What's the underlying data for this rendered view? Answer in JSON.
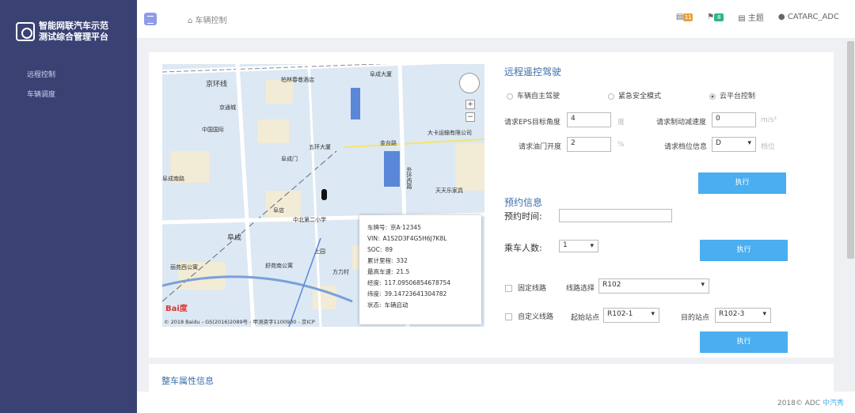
{
  "app": {
    "title_line1": "智能网联汽车示范",
    "title_line2": "测试综合管理平台"
  },
  "sidebar": {
    "items": [
      {
        "label": "远程控制"
      },
      {
        "label": "车辆调度"
      }
    ]
  },
  "header": {
    "breadcrumb": "车辆控制",
    "notif_count": "11",
    "msg_count": "8",
    "theme_label": "主题",
    "user": "CATARC_ADC"
  },
  "map": {
    "labels": [
      "京环线",
      "柏林春巷酒店",
      "阜成大厦",
      "京通城",
      "中国国际",
      "大卡运输有限公司",
      "金台路",
      "五环大厦",
      "外环西路",
      "阜成",
      "天天乐家具",
      "阜成门",
      "阜成南路",
      "上园",
      "方力村",
      "舒苑南公寓",
      "丽苑西公寓",
      "中北第二小学",
      "阜店"
    ],
    "copyright": "© 2018 Baidu - GS(2016)2089号 - 甲测资字1100930 - 京ICP",
    "logo": "Bai度"
  },
  "popup": {
    "rows": [
      {
        "k": "车牌号:",
        "v": "京A·12345"
      },
      {
        "k": "VIN:",
        "v": "A1S2D3F4G5H6J7K8L"
      },
      {
        "k": "SOC:",
        "v": "89"
      },
      {
        "k": "累计里程:",
        "v": "332"
      },
      {
        "k": "最高车速:",
        "v": "21.5"
      },
      {
        "k": "经度:",
        "v": "117.09506854678754"
      },
      {
        "k": "纬度:",
        "v": "39.14723641304782"
      },
      {
        "k": "状态:",
        "v": "车辆启动"
      }
    ]
  },
  "remote": {
    "title": "远程遥控驾驶",
    "modes": [
      {
        "label": "车辆自主驾驶",
        "checked": false
      },
      {
        "label": "紧急安全模式",
        "checked": false
      },
      {
        "label": "云平台控制",
        "checked": true
      }
    ],
    "eps_label": "请求EPS目标角度",
    "eps_value": "4",
    "eps_unit": "度",
    "brake_label": "请求制动减速度",
    "brake_value": "0",
    "brake_unit": "m/s²",
    "throttle_label": "请求油门开度",
    "throttle_value": "2",
    "throttle_unit": "%",
    "gear_label": "请求档位信息",
    "gear_value": "D",
    "gear_unit": "档位",
    "exec": "执行"
  },
  "booking": {
    "title": "预约信息",
    "time_label": "预约时间:",
    "time_value": "",
    "passengers_label": "乘车人数:",
    "passengers_value": "1",
    "exec": "执行",
    "fixed_label": "固定线路",
    "route_label": "线路选择",
    "route_value": "R102",
    "custom_label": "自定义线路",
    "start_label": "起始站点",
    "start_value": "R102-1",
    "dest_label": "目的站点",
    "dest_value": "R102-3",
    "exec2": "执行"
  },
  "vehicle_attr": {
    "title": "整车属性信息"
  },
  "footer": {
    "text": "2018© ADC",
    "link": "中汽秀"
  },
  "colors": {
    "sidebar": "#3a4274",
    "button": "#4aaef0",
    "title": "#3a6ea8"
  }
}
